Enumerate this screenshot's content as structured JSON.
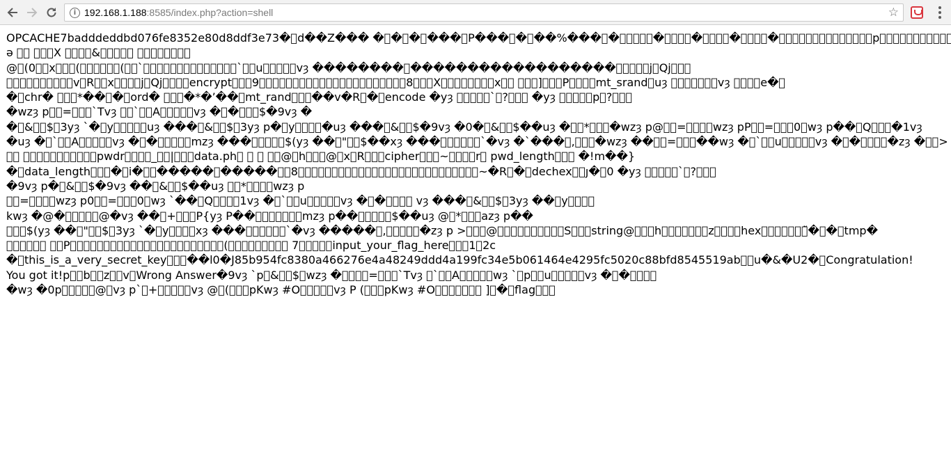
{
  "browser": {
    "url_host": "192.168.1.188",
    "url_rest": ":8585/index.php?action=shell",
    "icons": {
      "back": "arrow-left-icon",
      "forward": "arrow-right-icon",
      "reload": "reload-icon",
      "info": "info-icon",
      "bookmark": "star-icon",
      "extension": "extension-icon",
      "menu": "menu-icon"
    }
  },
  "content": {
    "lines": [
      "OPCACHE7badddeddbd076fe8352e80d8ddf3e73�\u0000d��Z��� �\u0000�\u0000�\u0000���\u0000P���\u0000�\u0000��%���\u0000�\u0000\u0000\u0000\u0000\u0000�\u0000\u0000\u0000\u0000�\u0000\u0000\u0000\u0000�\u0000\u0000\u0000\u0000�\u0000\u0000\u0000\u0000\u0000\u0000\u0000\u0000\u0000\u0000\u0000\u0000\u0000\u0000p\u0000\u0000\u0000\u0000\u0000\u0000\u0000\u0000\u0000\u0000\u0000\u0000\u0000\u0000\u0000\u0000\u0000\u0000\u0000\u0000\u0000\u0000\u0000\u0000\u0000\u0000\u0000\u0000�\u0000\u0000\u0000\u0000\u0000\u0000\u0000\u0000\u0000\u0000\u0000\u0000\u0000\u0000\u0000p\u0000\u0000\u0000\u0000\u0000\u0000\u0000\u0000\u0000\u0000\u0000\u0000\u0000\u0000\u0000\u0000\u0000",
      "ə \u0000\u0000 \u0000\u0000\u0000X \u0000\u0000\u0000\u0000&\u0000\u0000\u0000\u0000\u0000 \u0000\u0000\u0000\u0000\u0000\u0000\u0000\u0000",
      "@\u0000(0\u0000\u0000x\u0000\u0000\u0000(\u0000\u0000\u0000\u0000\u0000\u0000(\u0000\u0000`\u0000\u0000\u0000\u0000\u0000\u0000\u0000\u0000\u0000\u0000\u0000\u0000\u0000\u0000`\u0000\u0000u\u0000\u0000\u0000\u0000\u0000vȝ ��������\u0000������������������\u0000\u0000\u0000\u0000\u0000j\u0000Qj\u0000\u0000\u0000",
      "\u0000\u0000\u0000\u0000\u0000\u0000\u0000\u0000\u0000\u0000v\u0000R\u0000\u0000x\u0000\u0000\u0000\u0000j\u0000Qj\u0000\u0000\u0000\u0000encrypt\u0000\u0000\u00009\u0000\u0000\u0000\u0000\u0000\u0000\u0000\u0000\u0000\u0000\u0000\u0000\u0000\u0000\u0000\u0000\u0000\u0000\u0000\u0000\u0000\u00008\u0000\u0000\u0000X\u0000\u0000\u0000\u0000\u0000\u0000\u0000\u0000x\u0000\u0000 \u0000\u0000\u0000]\u0000\u0000\u0000P\u0000\u0000\u0000\u0000mt_srand\u0000uȝ \u0000\u0000\u0000\u0000\u0000\u0000\u0000vȝ \u0000\u0000\u0000\u0000e�\u0000",
      "�\u0000chr� \u0000\u0000\u0000*��\u0000�\u0000ord� \u0000\u0000\u0000�*�’��\u0000mt_rand\u0000\u0000\u0000��v�R\u0000�\u0000encode �yȝ \u0000\u0000\u0000\u0000\u0000`\u0000?\u0000\u0000\u0000 �yȝ \u0000\u0000\u0000\u0000\u0000p\u0000?\u0000\u0000\u0000",
      "�wzȝ p\u0000\u0000=\u0000\u0000\u0000`Tvȝ \u0000\u0000`\u0000\u0000A\u0000\u0000\u0000\u0000\u0000vȝ �\u0000�\u0000\u0000\u0000$�9vȝ �",
      "�\u0000&\u0000\u0000$\u00003yȝ `�\u0000y\u0000\u0000\u0000\u0000\u0000uȝ ���\u0000&\u0000\u0000$\u00003yȝ p�\u0000y\u0000\u0000\u0000\u0000�uȝ ���\u0000&\u0000\u0000$�9vȝ �0�\u0000&\u0000\u0000$��uȝ �\u0000\u0000*\u0000\u0000\u0000�wzȝ p@\u0000\u0000=\u0000\u0000\u0000\u0000wzȝ pP\u0000\u0000=\u0000\u0000\u00000\u0000wȝ p��\u0000Q\u0000\u0000\u0000�1vȝ",
      "�uȝ �\u0000`\u0000\u0000A\u0000\u0000\u0000\u0000\u0000vȝ �\u0000�\u0000\u0000\u0000\u0000\u0000mzȝ ���\u0000\u0000\u0000\u0000\u0000$(yȝ ��\u0000\"\u0000\u0000$��xȝ ���\u0000\u0000\u0000\u0000\u0000\u0000`�vȝ �`���\u0000,\u0000\u0000\u0000�wzȝ ��\u0000\u0000=\u0000\u0000\u0000��wȝ �\u0000`\u0000\u0000u\u0000\u0000\u0000\u0000\u0000vȝ �\u0000�\u0000\u0000\u0000\u0000�zȝ �\u0000\u0000>",
      "\u0000\u0000 \u0000\u0000\u0000\u0000\u0000\u0000\u0000\u0000\u0000\u0000\u0000pwdr\u0000\u0000\u0000\u0000_\u0000\u0000|\u0000\u0000\u0000data.ph\u0000 \u0000 \u0000 \u0000\u0000@\u0000h\u0000\u0000\u0000@\u0000x\u0000R\u0000\u0000\u0000cipher\u0000\u0000\u0000~\u0000\u0000\u0000\u0000r\u0000 pwd_length\u0000\u0000\u0000 �!m��}",
      "�\u0000data_length\u0000\u0000\u0000�\u0000i�\u0000\u0000�����\u0000�����\u0000\u00008\u0000\u0000\u0000\u0000\u0000\u0000\u0000\u0000\u0000\u0000\u0000\u0000\u0000\u0000\u0000\u0000\u0000\u0000\u0000\u0000\u0000\u0000\u0000\u0000\u0000\u0000\u0000~�R\u0000�\u0000dechex\u0000\u0000ȷ�\u00000 �yȝ \u0000\u0000\u0000\u0000\u0000`\u0000?\u0000\u0000\u0000",
      "�9vȝ p�\u0000&\u0000\u0000$�9vȝ ��\u0000&\u0000\u0000$��uȝ \u0000\u0000*\u0000\u0000\u0000\u0000wzȝ p",
      "\u0000\u0000=\u0000\u0000\u0000\u0000wzȝ p0\u0000\u0000=\u0000\u0000\u00000\u0000wȝ `��\u0000Q\u0000\u0000\u0000\u00001vȝ �\u0000`\u0000\u0000u\u0000\u0000\u0000\u0000\u0000vȝ �\u0000�\u0000\u0000\u0000\u0000 vȝ ���\u0000&\u0000\u0000$\u00003yȝ ��\u0000y\u0000\u0000\u0000\u0000",
      "kwȝ �@�\u0000\u0000\u0000\u0000\u0000@�vȝ ��\u0000+\u0000\u0000\u0000P{yȝ P��\u0000\u0000\u0000\u0000\u0000\u0000\u0000mzȝ p��\u0000\u0000\u0000\u0000\u0000$��uȝ @\u0000*\u0000\u0000\u0000azȝ p��",
      "\u0000\u0000\u0000$(yȝ ��\u0000\"\u0000\u0000$\u00003yȝ `�\u0000y\u0000\u0000\u0000\u0000xȝ ���\u0000\u0000\u0000\u0000\u0000\u0000`�vȝ �����\u0000,\u0000\u0000\u0000\u0000\u0000�zȝ p >\u0000\u0000\u0000@\u0000\u0000\u0000\u0000\u0000\u0000\u0000\u0000\u0000\u0000S\u0000\u0000\u0000string@\u0000\u0000\u0000h\u0000\u0000\u0000\u0000\u0000\u0000\u0000z\u0000\u0000\u0000\u0000hex\u0000\u0000\u0000\u0000\u0000\u0000\u0000̃�\u0000�\u0000tmp�",
      "\u0000\u0000\u0000\u0000\u0000\u0000 \u0000\u0000P\u0000\u0000\u0000\u0000\u0000\u0000\u0000\u0000\u0000\u0000\u0000\u0000\u0000\u0000\u0000\u0000\u0000\u0000\u0000\u0000\u0000\u0000\u0000(\u0000\u0000\u0000\u0000\u0000\u0000\u0000\u0000\u0000 7\u0000\u0000\u0000\u0000\u0000input_your_flag_here\u0000\u0000\u00001\u00002c",
      "�\u0000this_is_a_very_secret_key\u0000\u0000\u0000��l0�J85b954fc8380a466276e4a48249ddd4a199fc34e5b061464e4295fc5020c88bfd8545519ab\u0000\u0000u�&�U2�\u0000Congratulation! You got it!p\u0000\u0000b\u0000\u0000z\u0000\u0000v\u0000Wrong Answer�9vȝ `p\u0000&\u0000\u0000$\u0000wzȝ �\u0000\u0000\u0000\u0000=\u0000\u0000\u0000`Tvȝ \u0000`\u0000\u0000A\u0000\u0000\u0000\u0000\u0000wȝ `\u0000p\u0000\u0000u\u0000\u0000\u0000\u0000\u0000vȝ �\u0000�\u0000\u0000\u0000\u0000",
      "�wȝ �0p\u0000\u0000\u0000\u0000\u0000@\u0000vȝ p`\u0000+\u0000\u0000\u0000\u0000\u0000vȝ @\u0000(\u0000\u0000\u0000pKwȝ #O\u0000\u0000\u0000\u0000\u0000vȝ P (\u0000\u0000\u0000pKwȝ #O\u0000\u0000\u0000\u0000\u0000\u0000\u0000 ]\u0000�\u0000flag\u0000\u0000\u0000"
    ]
  }
}
